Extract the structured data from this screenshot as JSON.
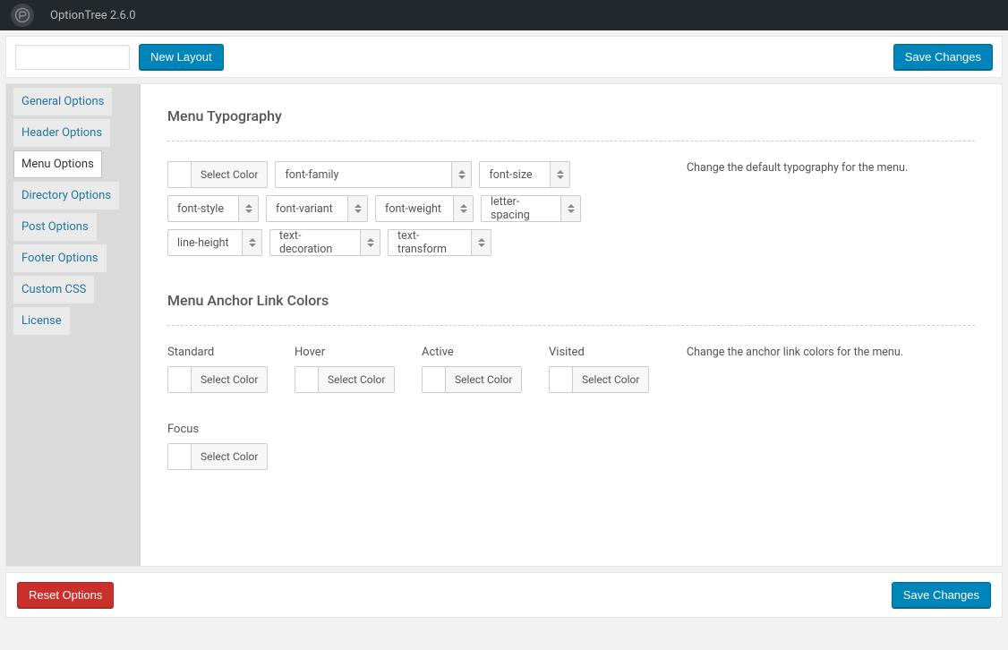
{
  "header": {
    "app_title": "OptionTree 2.6.0"
  },
  "toolbar": {
    "layout_input_value": "",
    "new_layout_label": "New Layout",
    "save_label": "Save Changes"
  },
  "sidebar": {
    "items": [
      {
        "label": "General Options",
        "active": false
      },
      {
        "label": "Header Options",
        "active": false
      },
      {
        "label": "Menu Options",
        "active": true
      },
      {
        "label": "Directory Options",
        "active": false
      },
      {
        "label": "Post Options",
        "active": false
      },
      {
        "label": "Footer Options",
        "active": false
      },
      {
        "label": "Custom CSS",
        "active": false
      },
      {
        "label": "License",
        "active": false
      }
    ]
  },
  "sections": {
    "typography": {
      "title": "Menu Typography",
      "select_color_label": "Select Color",
      "selects": {
        "font_family": "font-family",
        "font_size": "font-size",
        "font_style": "font-style",
        "font_variant": "font-variant",
        "font_weight": "font-weight",
        "letter_spacing": "letter-spacing",
        "line_height": "line-height",
        "text_decoration": "text-decoration",
        "text_transform": "text-transform"
      },
      "description": "Change the default typography for the menu."
    },
    "anchor": {
      "title": "Menu Anchor Link Colors",
      "select_color_label": "Select Color",
      "labels": {
        "standard": "Standard",
        "hover": "Hover",
        "active": "Active",
        "visited": "Visited",
        "focus": "Focus"
      },
      "description": "Change the anchor link colors for the menu."
    }
  },
  "footer": {
    "reset_label": "Reset Options",
    "save_label": "Save Changes"
  }
}
